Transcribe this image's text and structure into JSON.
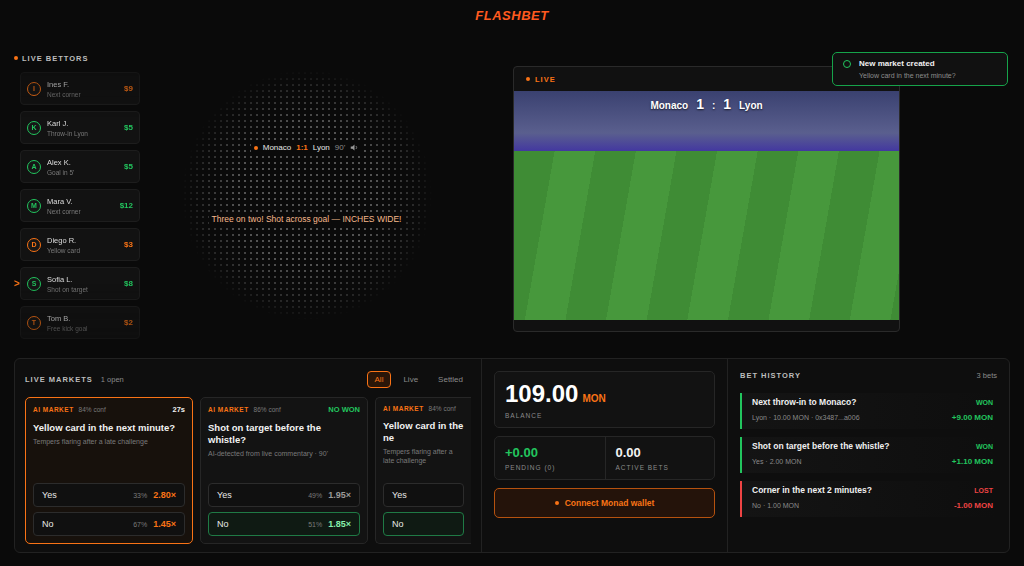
{
  "brand": "FLASHBET",
  "bettors": {
    "title": "LIVE BETTORS",
    "marker": ">",
    "items": [
      {
        "initial": "I",
        "name": "Ines F.",
        "bet": "Next corner",
        "amount": "$9",
        "color": "#f97316",
        "selected": false
      },
      {
        "initial": "K",
        "name": "Karl J.",
        "bet": "Throw-in Lyon",
        "amount": "$5",
        "color": "#22c55e",
        "selected": false
      },
      {
        "initial": "A",
        "name": "Alex K.",
        "bet": "Goal in 5'",
        "amount": "$5",
        "color": "#22c55e",
        "selected": false
      },
      {
        "initial": "M",
        "name": "Mara V.",
        "bet": "Next corner",
        "amount": "$12",
        "color": "#22c55e",
        "selected": false
      },
      {
        "initial": "D",
        "name": "Diego R.",
        "bet": "Yellow card",
        "amount": "$3",
        "color": "#f97316",
        "selected": false
      },
      {
        "initial": "S",
        "name": "Sofia L.",
        "bet": "Shot on target",
        "amount": "$8",
        "color": "#22c55e",
        "selected": true
      },
      {
        "initial": "T",
        "name": "Tom B.",
        "bet": "Free kick goal",
        "amount": "$2",
        "color": "#f97316",
        "selected": false
      }
    ]
  },
  "commentary": {
    "home": "Monaco",
    "score": "1:1",
    "away": "Lyon",
    "minute": "90'",
    "text": "Three on two! Shot across goal — INCHES WIDE!"
  },
  "video": {
    "label": "LIVE",
    "home": "Monaco",
    "home_score": "1",
    "separator": ":",
    "away_score": "1",
    "away": "Lyon"
  },
  "toast": {
    "title": "New market created",
    "text": "Yellow card in the next minute?"
  },
  "markets": {
    "title": "LIVE MARKETS",
    "count": "1 open",
    "tabs": [
      {
        "label": "All",
        "selected": true
      },
      {
        "label": "Live",
        "selected": false
      },
      {
        "label": "Settled",
        "selected": false
      }
    ],
    "cards": [
      {
        "tag": "AI MARKET",
        "conf": "84% conf",
        "status": "27s",
        "won": false,
        "selected": true,
        "question": "Yellow card in the next minute?",
        "note": "Tempers flaring after a late challenge",
        "options": [
          {
            "label": "Yes",
            "pct": "33%",
            "odds": "2.80×",
            "selected": false
          },
          {
            "label": "No",
            "pct": "67%",
            "odds": "1.45×",
            "selected": false
          }
        ]
      },
      {
        "tag": "AI MARKET",
        "conf": "86% conf",
        "status": "NO WON",
        "won": true,
        "selected": false,
        "question": "Shot on target before the whistle?",
        "note": "AI-detected from live commentary · 90'",
        "options": [
          {
            "label": "Yes",
            "pct": "49%",
            "odds": "1.95×",
            "selected": false
          },
          {
            "label": "No",
            "pct": "51%",
            "odds": "1.85×",
            "selected": true
          }
        ]
      },
      {
        "tag": "AI MARKET",
        "conf": "84% conf",
        "status": "",
        "won": false,
        "selected": false,
        "question": "Yellow card in the ne",
        "note": "Tempers flaring after a late challenge",
        "options": [
          {
            "label": "Yes",
            "pct": "",
            "odds": "",
            "selected": false
          },
          {
            "label": "No",
            "pct": "",
            "odds": "",
            "selected": true
          }
        ]
      }
    ]
  },
  "wallet": {
    "balance": "109.00",
    "currency": "MON",
    "balance_label": "BALANCE",
    "pending": "+0.00",
    "pending_label": "PENDING (0)",
    "active": "0.00",
    "active_label": "ACTIVE BETS",
    "button": "Connect Monad wallet"
  },
  "history": {
    "title": "BET HISTORY",
    "count": "3 bets",
    "items": [
      {
        "question": "Next throw-in to Monaco?",
        "result": "WON",
        "won": true,
        "detail": "Lyon · 10.00 MON · 0x3487...a006",
        "amount": "+9.00 MON"
      },
      {
        "question": "Shot on target before the whistle?",
        "result": "WON",
        "won": true,
        "detail": "Yes · 2.00 MON",
        "amount": "+1.10 MON"
      },
      {
        "question": "Corner in the next 2 minutes?",
        "result": "LOST",
        "won": false,
        "detail": "No · 1.00 MON",
        "amount": "-1.00 MON"
      }
    ]
  }
}
